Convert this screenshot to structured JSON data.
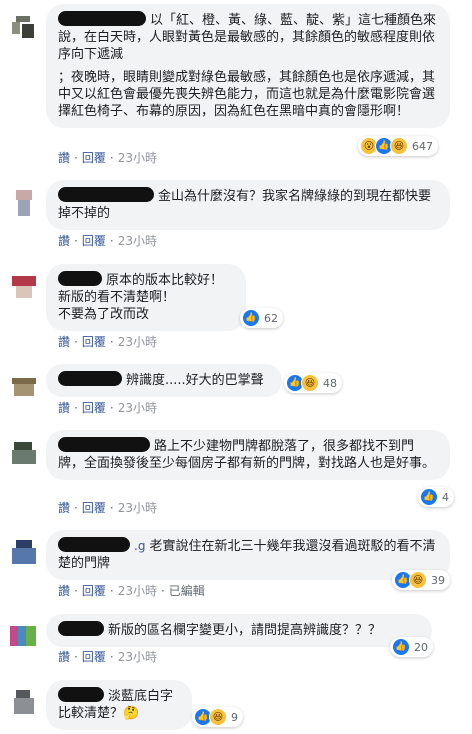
{
  "ui": {
    "like_label": "讚",
    "reply_label": "回覆",
    "separator": "·",
    "edited_label": "已編輯"
  },
  "colors": {
    "bubble_bg": "#f2f3f5",
    "link": "#385898",
    "meta": "#606770",
    "like_blue": "#1877f2",
    "emoji_yellow": "#f7c13c"
  },
  "comments": [
    {
      "paragraphs": [
        "以「紅、橙、黃、綠、藍、靛、紫」這七種顏色來說，在白天時，人眼對黃色是最敏感的，其餘顏色的敏感程度則依序向下遞減",
        "；夜晚時，眼睛則變成對綠色最敏感，其餘顏色也是依序遞減，其中又以紅色會最優先喪失辨色能力，而這也就是為什麼電影院會選擇紅色椅子、布幕的原因，因為紅色在黑暗中真的會隱形啊！"
      ],
      "time": "23小時",
      "reactions": [
        "wow-icon",
        "like-icon",
        "haha-icon"
      ],
      "reaction_count": "647"
    },
    {
      "paragraphs": [
        "金山為什麼沒有？我家名牌綠綠的到現在都快要掉不掉的"
      ],
      "time": "23小時"
    },
    {
      "paragraphs": [
        "原本的版本比較好！\n新版的看不清楚啊！\n不要為了改而改"
      ],
      "time": "23小時",
      "reactions": [
        "like-icon"
      ],
      "reaction_count": "62"
    },
    {
      "paragraphs": [
        "辨識度.....好大的巴掌聲"
      ],
      "time": "23小時",
      "reactions": [
        "like-icon",
        "haha-icon"
      ],
      "reaction_count": "48"
    },
    {
      "paragraphs": [
        "路上不少建物門牌都脫落了，很多都找不到門牌，全面換發後至少每個房子都有新的門牌，對找路人也是好事。"
      ],
      "time": "23小時",
      "reactions": [
        "like-icon"
      ],
      "reaction_count": "4"
    },
    {
      "paragraphs": [
        "老實說住在新北三十幾年我還沒看過斑駁的看不清楚的門牌"
      ],
      "time": "23小時",
      "edited": true,
      "reactions": [
        "like-icon",
        "haha-icon"
      ],
      "reaction_count": "39"
    },
    {
      "paragraphs": [
        "新版的區名欄字變更小，請問提高辨識度？？？"
      ],
      "time": "23小時",
      "reactions": [
        "like-icon"
      ],
      "reaction_count": "20"
    },
    {
      "paragraphs": [
        "淡藍底白字\n比較清楚？🤔"
      ],
      "reactions": [
        "like-icon",
        "haha-icon"
      ],
      "reaction_count": "9"
    }
  ]
}
